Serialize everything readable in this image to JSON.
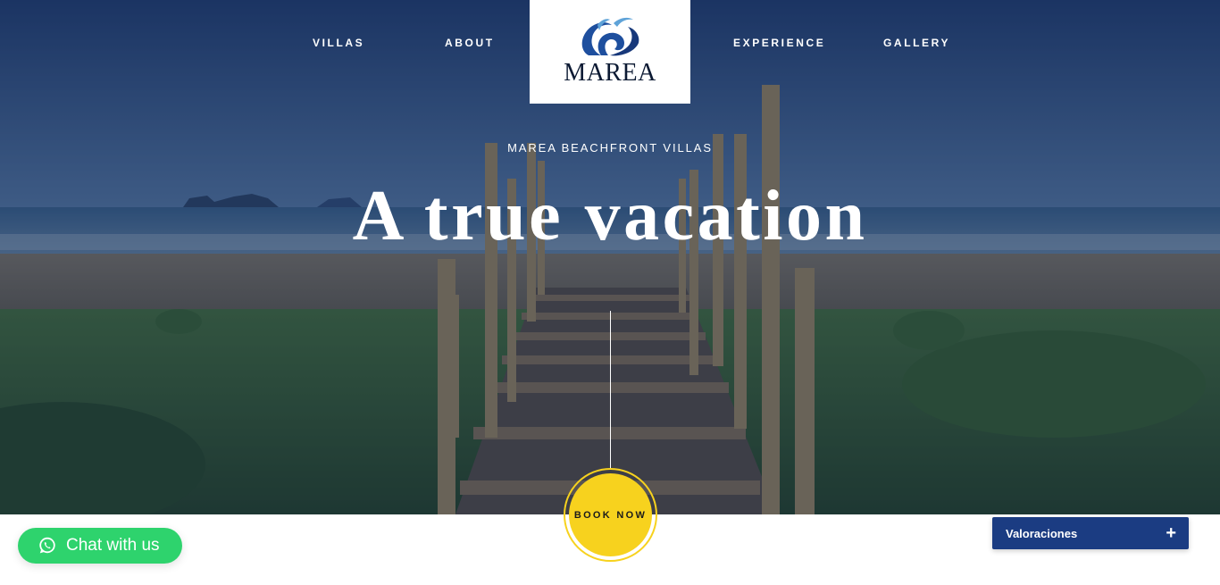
{
  "nav": {
    "villas": "VILLAS",
    "about": "ABOUT",
    "experience": "EXPERIENCE",
    "gallery": "GALLERY"
  },
  "logo": {
    "text": "MAREA",
    "icon": "wave-logo-icon",
    "color": "#1e4f9e"
  },
  "hero": {
    "kicker": "MAREA BEACHFRONT VILLAS",
    "headline": "A true vacation",
    "overlay_color": "#10264e"
  },
  "book": {
    "label": "BOOK NOW",
    "color": "#f7d21e"
  },
  "chat": {
    "label": "Chat with us",
    "icon": "whatsapp-icon",
    "color": "#2ed36d"
  },
  "reviews": {
    "label": "Valoraciones",
    "icon": "plus-icon",
    "symbol": "+",
    "color": "#1b3c82"
  }
}
